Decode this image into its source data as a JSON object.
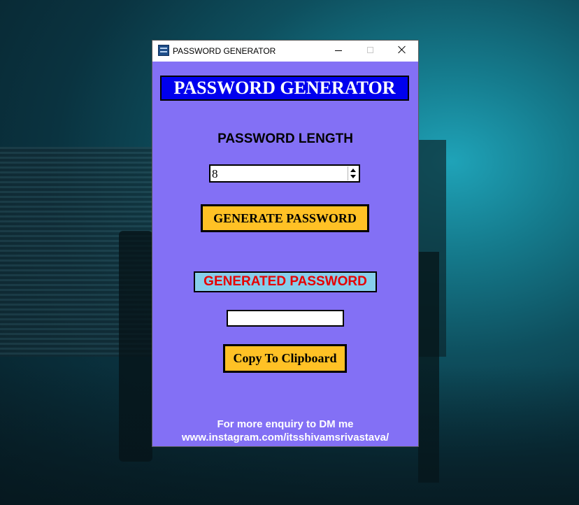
{
  "window": {
    "title": "PASSWORD GENERATOR",
    "icon": "app-icon",
    "controls": [
      "minimize-icon",
      "maximize-icon",
      "close-icon"
    ]
  },
  "app": {
    "heading": "PASSWORD GENERATOR",
    "length_label": "PASSWORD LENGTH",
    "length_value": "8",
    "generate_button": "GENERATE PASSWORD",
    "generated_label": "GENERATED PASSWORD",
    "generated_password": "",
    "copy_button": "Copy To Clipboard",
    "footer_line1": "For more enquiry to DM me",
    "footer_line2": "www.instagram.com/itsshivamsrivastava/"
  },
  "colors": {
    "window_bg": "#8370f5",
    "heading_bg": "#0000ee",
    "button_bg": "#ffc125",
    "generated_label_bg": "#87ceeb",
    "generated_label_text": "#e60000"
  }
}
